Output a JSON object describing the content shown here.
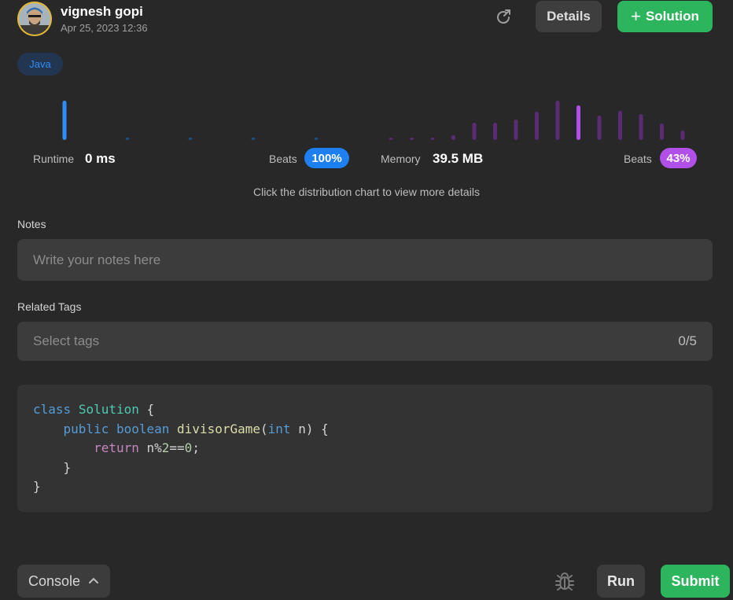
{
  "header": {
    "username": "vignesh gopi",
    "timestamp": "Apr 25, 2023 12:36",
    "details_label": "Details",
    "solution_label": "Solution",
    "share_icon": "share-arrow-icon"
  },
  "language_tag": "Java",
  "runtime": {
    "label": "Runtime",
    "value": "0 ms",
    "beats_label": "Beats",
    "beats_value": "100%",
    "color": "#2e8ef7"
  },
  "memory": {
    "label": "Memory",
    "value": "39.5 MB",
    "beats_label": "Beats",
    "beats_value": "43%",
    "color": "#b050e8"
  },
  "chart_data": [
    {
      "type": "bar",
      "series": [
        {
          "values": [
            50,
            3,
            3,
            3,
            3
          ],
          "highlight_index": 0
        }
      ],
      "color": "#2e8ef7",
      "dim_color": "#1d4f86"
    },
    {
      "type": "bar",
      "series": [
        {
          "values": [
            3,
            3,
            3,
            6,
            22,
            22,
            26,
            36,
            50,
            44,
            31,
            37,
            33,
            21,
            12
          ],
          "highlight_index": 9
        }
      ],
      "color": "#b050e8",
      "dim_color": "#5a2c74"
    }
  ],
  "hint": "Click the distribution chart to view more details",
  "notes": {
    "label": "Notes",
    "placeholder": "Write your notes here"
  },
  "tags": {
    "label": "Related Tags",
    "placeholder": "Select tags",
    "count": "0/5"
  },
  "code": {
    "language": "Java",
    "lines": [
      "class Solution {",
      "    public boolean divisorGame(int n) {",
      "        return n%2==0;",
      "    }",
      "}"
    ]
  },
  "footer": {
    "console_label": "Console",
    "run_label": "Run",
    "submit_label": "Submit",
    "bug_icon": "bug-icon"
  },
  "colors": {
    "background": "#282828",
    "accent_green": "#2db55d",
    "tag_blue": "#2e8ef7"
  }
}
